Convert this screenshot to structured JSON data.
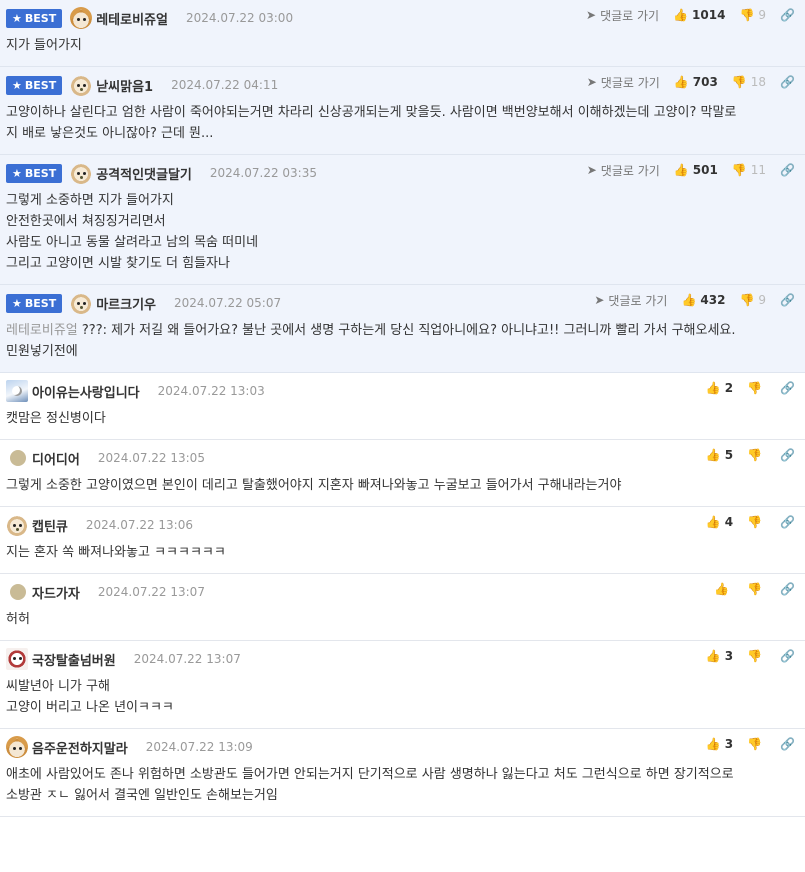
{
  "labels": {
    "best": "BEST",
    "reply": "댓글로 가기"
  },
  "icons": {
    "star": "star-icon",
    "reply": "send-arrow-icon",
    "like": "thumbs-up-icon",
    "dislike": "thumbs-down-icon",
    "link": "link-icon"
  },
  "colors": {
    "best_bg": "#f0f4fc",
    "badge": "#3b6fd4"
  },
  "comments": [
    {
      "best": true,
      "avatar": "fox",
      "nick": "레테로비쥬얼",
      "date": "2024.07.22 03:00",
      "likes": "1014",
      "dislikes": "9",
      "lines": [
        "지가 들어가지"
      ]
    },
    {
      "best": true,
      "avatar": "dog",
      "nick": "낟씨맑음1",
      "date": "2024.07.22 04:11",
      "likes": "703",
      "dislikes": "18",
      "lines": [
        "고양이하나 살린다고 엄한 사람이 죽어야되는거면 차라리 신상공개되는게 맞을듯. 사람이면 백번양보해서 이해하겠는데 고양이? 막말로",
        "지 배로 낳은것도 아니잖아? 근데 뭔..."
      ]
    },
    {
      "best": true,
      "avatar": "dog",
      "nick": "공격적인댓글달기",
      "date": "2024.07.22 03:35",
      "likes": "501",
      "dislikes": "11",
      "lines": [
        "그렇게 소중하면 지가 들어가지",
        "안전한곳에서 쳐징징거리면서",
        "사람도 아니고 동물 살려라고 남의 목숨 떠미네",
        "그리고 고양이면 시발 찾기도 더 힘들자나"
      ]
    },
    {
      "best": true,
      "avatar": "dog",
      "nick": "마르크기우",
      "date": "2024.07.22 05:07",
      "likes": "432",
      "dislikes": "9",
      "mention": "레테로비쥬얼",
      "lines": [
        " ???: 제가 저길 왜 들어가요? 불난 곳에서 생명 구하는게 당신 직업아니에요? 아니냐고!! 그러니까 빨리 가서 구해오세요.",
        "민원넣기전에"
      ]
    },
    {
      "best": false,
      "avatar": "photo",
      "nick": "아이유는사랑입니다",
      "date": "2024.07.22 13:03",
      "likes": "2",
      "dislikes": "",
      "lines": [
        "캣맘은 정신병이다"
      ]
    },
    {
      "best": false,
      "avatar": "dot",
      "nick": "디어디어",
      "date": "2024.07.22 13:05",
      "likes": "5",
      "dislikes": "",
      "lines": [
        "그렇게 소중한 고양이였으면 본인이 데리고 탈출했어야지 지혼자 빠져나와놓고 누굴보고 들어가서 구해내라는거야"
      ]
    },
    {
      "best": false,
      "avatar": "dog",
      "nick": "캡틴큐",
      "date": "2024.07.22 13:06",
      "likes": "4",
      "dislikes": "",
      "lines": [
        "지는 혼자 쏙 빠져나와놓고 ㅋㅋㅋㅋㅋㅋ"
      ]
    },
    {
      "best": false,
      "avatar": "dot",
      "nick": "자드가자",
      "date": "2024.07.22 13:07",
      "likes": "",
      "dislikes": "",
      "lines": [
        "허허"
      ]
    },
    {
      "best": false,
      "avatar": "puppy",
      "nick": "국장탈출넘버원",
      "date": "2024.07.22 13:07",
      "likes": "3",
      "dislikes": "",
      "lines": [
        "씨발년아 니가 구해",
        "고양이 버리고 나온 년이ㅋㅋㅋ"
      ]
    },
    {
      "best": false,
      "avatar": "fox",
      "nick": "음주운전하지말라",
      "date": "2024.07.22 13:09",
      "likes": "3",
      "dislikes": "",
      "lines": [
        "애초에 사람있어도 존나 위험하면 소방관도 들어가면 안되는거지 단기적으로 사람 생명하나 잃는다고 처도 그런식으로 하면 장기적으로",
        "소방관 ㅈㄴ 잃어서 결국엔 일반인도 손해보는거임"
      ]
    }
  ]
}
